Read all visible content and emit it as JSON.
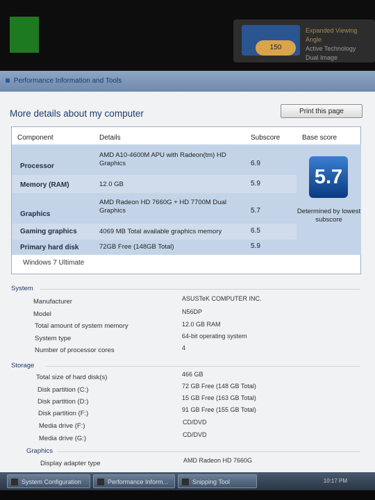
{
  "tray_widget": {
    "badge": "150",
    "line1": "Expanded Viewing Angle",
    "line2": "Active Technology",
    "line3": "Dual Image"
  },
  "window": {
    "title": "Performance Information and Tools"
  },
  "page": {
    "heading": "More details about my computer",
    "print_button": "Print this page"
  },
  "score_table": {
    "headers": {
      "component": "Component",
      "details": "Details",
      "subscore": "Subscore",
      "base_score": "Base score"
    },
    "rows": [
      {
        "component": "Processor",
        "details": "AMD A10-4600M APU with Radeon(tm) HD Graphics",
        "subscore": "6.9"
      },
      {
        "component": "Memory (RAM)",
        "details": "12.0 GB",
        "subscore": "5.9"
      },
      {
        "component": "Graphics",
        "details": "AMD Radeon HD 7660G + HD 7700M Dual Graphics",
        "subscore": "5.7"
      },
      {
        "component": "Gaming graphics",
        "details": "4069 MB Total available graphics memory",
        "subscore": "6.5"
      },
      {
        "component": "Primary hard disk",
        "details": "72GB Free (148GB Total)",
        "subscore": "5.9"
      }
    ],
    "base_score": "5.7",
    "base_caption": "Determined by lowest subscore",
    "edition": "Windows 7 Ultimate"
  },
  "system": {
    "title": "System",
    "items": [
      {
        "label": "Manufacturer",
        "value": "ASUSTeK COMPUTER INC."
      },
      {
        "label": "Model",
        "value": "N56DP"
      },
      {
        "label": "Total amount of system memory",
        "value": "12.0 GB RAM"
      },
      {
        "label": "System type",
        "value": "64-bit operating system"
      },
      {
        "label": "Number of processor cores",
        "value": "4"
      }
    ]
  },
  "storage": {
    "title": "Storage",
    "items": [
      {
        "label": "Total size of hard disk(s)",
        "value": "466 GB"
      },
      {
        "label": "Disk partition (C:)",
        "value": "72 GB Free (148 GB Total)"
      },
      {
        "label": "Disk partition (D:)",
        "value": "15 GB Free (163 GB Total)"
      },
      {
        "label": "Disk partition (F:)",
        "value": "91 GB Free (155 GB Total)"
      },
      {
        "label": "Media drive (F:)",
        "value": "CD/DVD"
      },
      {
        "label": "Media drive (G:)",
        "value": "CD/DVD"
      }
    ]
  },
  "graphics": {
    "title": "Graphics",
    "items": [
      {
        "label": "Display adapter type",
        "value": "AMD Radeon HD 7660G"
      }
    ]
  },
  "taskbar": {
    "tasks": [
      "System Configuration",
      "Performance Inform...",
      "Snipping Tool"
    ],
    "clock": "10:17 PM"
  },
  "colors": {
    "row_highlight": "#c4d4e8",
    "heading_blue": "#1e3b6e",
    "score_tile": "#1f5fb5"
  }
}
